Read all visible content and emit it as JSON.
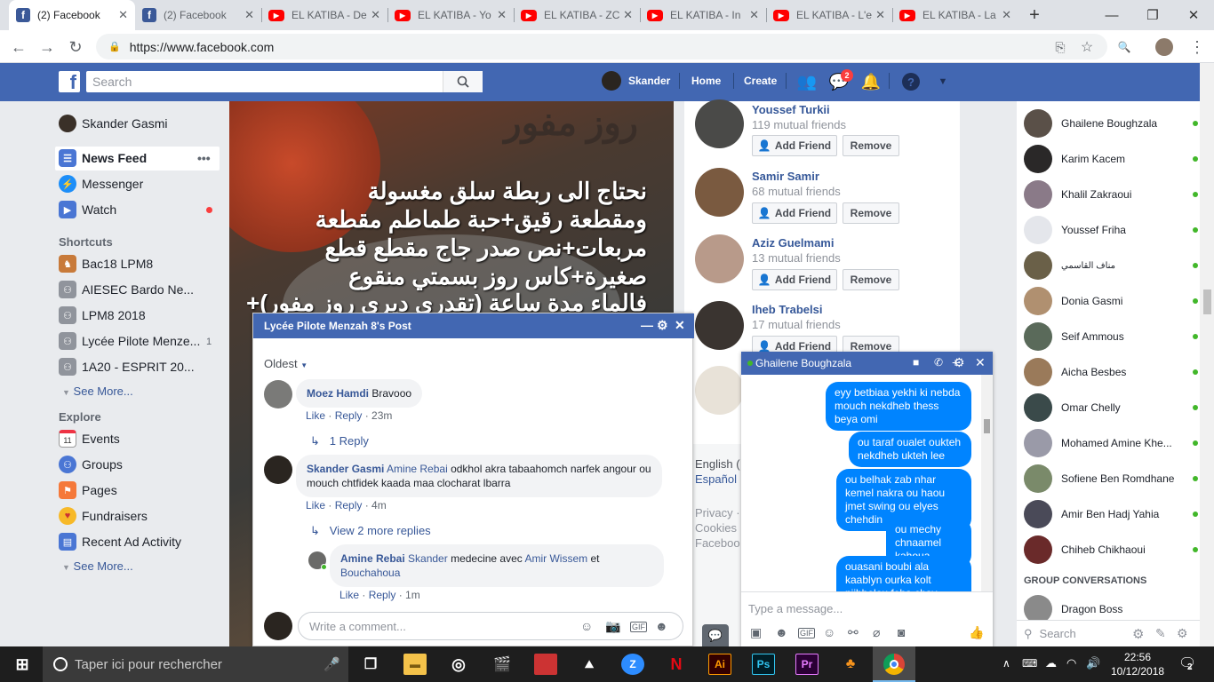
{
  "browser": {
    "tabs": [
      {
        "title": "(2) Facebook",
        "icon": "facebook-icon",
        "active": true
      },
      {
        "title": "(2) Facebook",
        "icon": "facebook-icon",
        "active": false
      },
      {
        "title": "EL KATIBA - De",
        "icon": "youtube-icon",
        "active": false
      },
      {
        "title": "EL KATIBA - Yo",
        "icon": "youtube-icon",
        "active": false
      },
      {
        "title": "EL KATIBA - ZC",
        "icon": "youtube-icon",
        "active": false
      },
      {
        "title": "EL KATIBA - In",
        "icon": "youtube-icon",
        "active": false
      },
      {
        "title": "EL KATIBA - L'e",
        "icon": "youtube-icon",
        "active": false
      },
      {
        "title": "EL KATIBA - La",
        "icon": "youtube-icon",
        "active": false
      }
    ],
    "url": "https://www.facebook.com"
  },
  "fb": {
    "search_placeholder": "Search",
    "user": "Skander",
    "home": "Home",
    "create": "Create",
    "messenger_badge": "2",
    "accent": "#4267b2"
  },
  "left": {
    "profile": "Skander Gasmi",
    "main": [
      {
        "label": "News Feed",
        "icon": "news-feed-icon"
      },
      {
        "label": "Messenger",
        "icon": "messenger-icon"
      },
      {
        "label": "Watch",
        "icon": "watch-icon"
      }
    ],
    "shortcuts_title": "Shortcuts",
    "shortcuts": [
      {
        "label": "Bac18 LPM8",
        "count": ""
      },
      {
        "label": "AIESEC Bardo Ne...",
        "count": ""
      },
      {
        "label": "LPM8 2018",
        "count": ""
      },
      {
        "label": "Lycée Pilote Menze...",
        "count": "1"
      },
      {
        "label": "1A20 - ESPRIT 20...",
        "count": ""
      }
    ],
    "see_more": "See More...",
    "explore_title": "Explore",
    "explore": [
      {
        "label": "Events",
        "icon": "calendar-icon",
        "day": "11"
      },
      {
        "label": "Groups",
        "icon": "groups-icon"
      },
      {
        "label": "Pages",
        "icon": "flag-icon"
      },
      {
        "label": "Fundraisers",
        "icon": "fundraiser-icon"
      },
      {
        "label": "Recent Ad Activity",
        "icon": "ad-activity-icon"
      }
    ]
  },
  "post_image_text": [
    "روز مفور",
    "نحتاج الى ربطة سلق مغسولة",
    "ومقطعة رقيق+حبة طماطم مقطعة",
    "مربعات+نص صدر جاج مقطع قطع",
    "صغيرة+كاس روز بسمتي منقوع",
    "فالماء مدة ساعة (تقدري ديري روز مفور)+"
  ],
  "pymk": [
    {
      "name": "Youssef Turkii",
      "mutual": "119 mutual friends"
    },
    {
      "name": "Samir Samir",
      "mutual": "68 mutual friends"
    },
    {
      "name": "Aziz Guelmami",
      "mutual": "13 mutual friends"
    },
    {
      "name": "Iheb Trabelsi",
      "mutual": "17 mutual friends"
    }
  ],
  "pymk_buttons": {
    "add": "Add Friend",
    "remove": "Remove"
  },
  "mid_footer": {
    "lang1": "English (",
    "lang2": "Español",
    "privacy": "Privacy ·",
    "cookies": "Cookies",
    "facebook": "Faceboo"
  },
  "popup": {
    "title": "Lycée Pilote Menzah 8's Post",
    "sort": "Oldest",
    "comments": [
      {
        "author": "Moez Hamdi",
        "mention": "",
        "text": "Bravooo",
        "like": "Like",
        "reply": "Reply",
        "time": "23m"
      },
      {
        "author": "Skander Gasmi",
        "mention": "Amine Rebai",
        "text": " odkhol akra tabaahomch narfek angour ou mouch chtfidek kaada maa clocharat lbarra",
        "like": "Like",
        "reply": "Reply",
        "time": "4m"
      },
      {
        "author": "Amine Rebai",
        "mention": "Skander",
        "text": " medecine avec ",
        "mention2": "Amir Wissem",
        "text2": " et ",
        "mention3": "Bouchahoua",
        "like": "Like",
        "reply": "Reply",
        "time": "1m"
      }
    ],
    "one_reply": "1 Reply",
    "more_replies": "View 2 more replies",
    "write_comment": "Write a comment..."
  },
  "chat": {
    "name": "Ghailene Boughzala",
    "messages": [
      "eyy betbiaa yekhi ki nebda mouch nekdheb thess beya omi",
      "ou taraf oualet oukteh nekdheb ukteh lee",
      "ou belhak zab nhar kemel nakra ou haou jmet swing ou elyes chehdin",
      "ou mechy chnaamel kahoua",
      "ouasani boubi ala kaablyn ourka kolt njibholou feha chay"
    ],
    "placeholder": "Type a message..."
  },
  "contacts": [
    "Ghailene Boughzala",
    "Karim Kacem",
    "Khalil Zakraoui",
    "Youssef Friha",
    "مناف القاسمي",
    "Donia Gasmi",
    "Seif Ammous",
    "Aicha Besbes",
    "Omar Chelly",
    "Mohamed Amine Khe...",
    "Sofiene Ben Romdhane",
    "Amir Ben Hadj Yahia",
    "Chiheb Chikhaoui"
  ],
  "group_conversations": "GROUP CONVERSATIONS",
  "group": "Dragon Boss",
  "chat_search": "Search",
  "taskbar": {
    "search": "Taper ici pour rechercher",
    "time": "22:56",
    "date": "10/12/2018",
    "notif": "2"
  }
}
